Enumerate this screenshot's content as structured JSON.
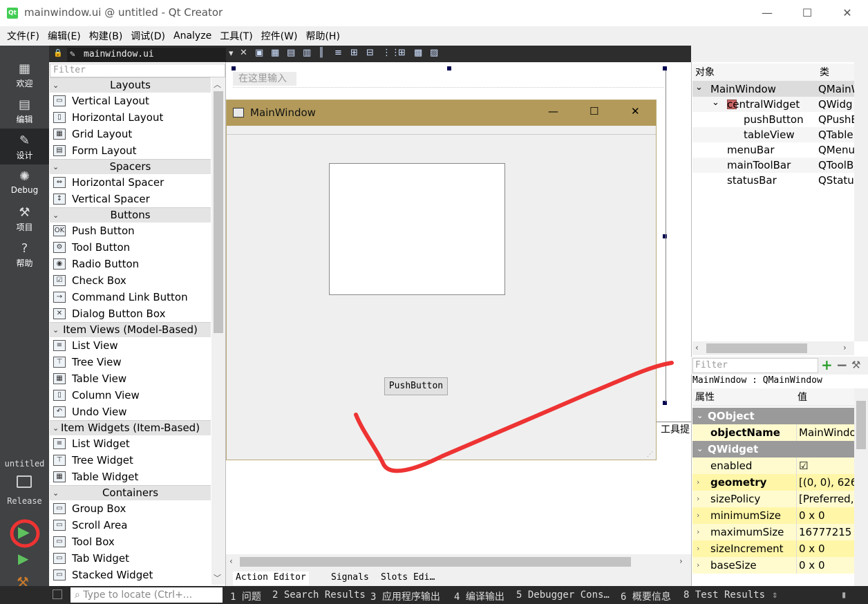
{
  "window": {
    "title": "mainwindow.ui @ untitled - Qt Creator",
    "minimize": "—",
    "maximize": "☐",
    "close": "✕"
  },
  "menu": [
    "文件(F)",
    "编辑(E)",
    "构建(B)",
    "调试(D)",
    "Analyze",
    "工具(T)",
    "控件(W)",
    "帮助(H)"
  ],
  "modes": [
    {
      "label": "欢迎",
      "icon": "grid-icon"
    },
    {
      "label": "编辑",
      "icon": "edit-icon"
    },
    {
      "label": "设计",
      "icon": "pencil-icon"
    },
    {
      "label": "Debug",
      "icon": "bug-icon"
    },
    {
      "label": "项目",
      "icon": "wrench-icon"
    },
    {
      "label": "帮助",
      "icon": "help-icon"
    }
  ],
  "kit": {
    "project": "untitled",
    "build": "Release"
  },
  "editor": {
    "tab": "mainwindow.ui",
    "menu_placeholder": "在这里输入"
  },
  "widgetbox": {
    "filter": "Filter",
    "categories": [
      {
        "name": "Layouts",
        "items": [
          "Vertical Layout",
          "Horizontal Layout",
          "Grid Layout",
          "Form Layout"
        ]
      },
      {
        "name": "Spacers",
        "items": [
          "Horizontal Spacer",
          "Vertical Spacer"
        ]
      },
      {
        "name": "Buttons",
        "items": [
          "Push Button",
          "Tool Button",
          "Radio Button",
          "Check Box",
          "Command Link Button",
          "Dialog Button Box"
        ]
      },
      {
        "name": "Item Views (Model-Based)",
        "items": [
          "List View",
          "Tree View",
          "Table View",
          "Column View",
          "Undo View"
        ]
      },
      {
        "name": "Item Widgets (Item-Based)",
        "items": [
          "List Widget",
          "Tree Widget",
          "Table Widget"
        ]
      },
      {
        "name": "Containers",
        "items": [
          "Group Box",
          "Scroll Area",
          "Tool Box",
          "Tab Widget",
          "Stacked Widget"
        ]
      }
    ]
  },
  "form": {
    "title": "MainWindow",
    "button": "PushButton",
    "side_label": "工具提"
  },
  "bottom_tabs": [
    "Action Editor",
    "Signals",
    "Slots Edi…"
  ],
  "object_inspector": {
    "headers": [
      "对象",
      "类"
    ],
    "rows": [
      {
        "name": "MainWindow",
        "cls": "QMainW",
        "indent": 0,
        "exp": "⌄"
      },
      {
        "name": "centralWidget",
        "cls": "QWidg",
        "indent": 1,
        "exp": "⌄"
      },
      {
        "name": "pushButton",
        "cls": "QPushB",
        "indent": 2,
        "exp": ""
      },
      {
        "name": "tableView",
        "cls": "QTable",
        "indent": 2,
        "exp": ""
      },
      {
        "name": "menuBar",
        "cls": "QMenu",
        "indent": 1,
        "exp": ""
      },
      {
        "name": "mainToolBar",
        "cls": "QToolB",
        "indent": 1,
        "exp": ""
      },
      {
        "name": "statusBar",
        "cls": "QStatu",
        "indent": 1,
        "exp": ""
      }
    ]
  },
  "property_editor": {
    "filter": "Filter",
    "context": "MainWindow : QMainWindow",
    "headers": [
      "属性",
      "值"
    ],
    "sections": [
      {
        "title": "QObject",
        "props": [
          {
            "k": "objectName",
            "v": "MainWindo",
            "bold": true,
            "exp": ""
          }
        ]
      },
      {
        "title": "QWidget",
        "props": [
          {
            "k": "enabled",
            "v": "☑",
            "bold": false,
            "exp": ""
          },
          {
            "k": "geometry",
            "v": "[(0, 0), 626 x",
            "bold": true,
            "exp": "›"
          },
          {
            "k": "sizePolicy",
            "v": "[Preferred,",
            "bold": false,
            "exp": "›"
          },
          {
            "k": "minimumSize",
            "v": "0 x 0",
            "bold": false,
            "exp": "›"
          },
          {
            "k": "maximumSize",
            "v": "16777215 x",
            "bold": false,
            "exp": "›"
          },
          {
            "k": "sizeIncrement",
            "v": "0 x 0",
            "bold": false,
            "exp": "›"
          },
          {
            "k": "baseSize",
            "v": "0 x 0",
            "bold": false,
            "exp": "›"
          }
        ]
      }
    ]
  },
  "statusbar": {
    "locate_placeholder": "Type to locate (Ctrl+...",
    "panes": [
      "1 问题",
      "2 Search Results",
      "3 应用程序输出",
      "4 编译输出",
      "5 Debugger Cons…",
      "6 概要信息",
      "8 Test Results"
    ]
  },
  "colors": {
    "form_titlebar": "#b39a5a",
    "mode_active": "#262829",
    "property_band": "#fffbcf",
    "section_band": "#9a9a9a"
  }
}
